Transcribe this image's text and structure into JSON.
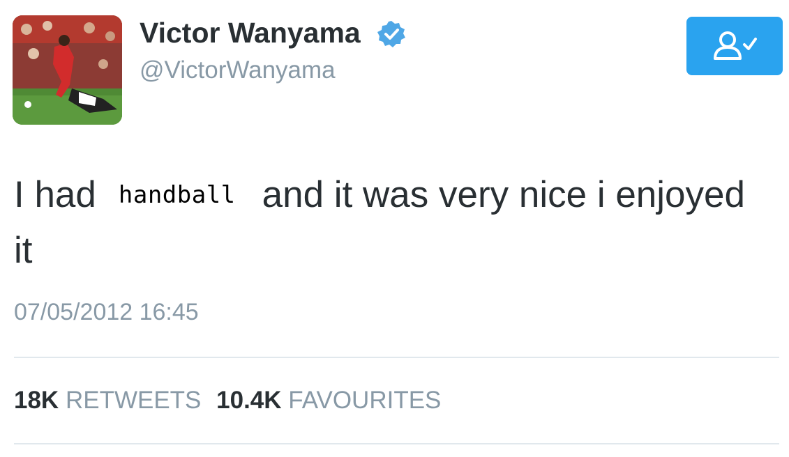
{
  "user": {
    "display_name": "Victor Wanyama",
    "handle": "@VictorWanyama",
    "verified": true,
    "avatar_icon": "football-player-photo"
  },
  "follow_button": {
    "icon": "user-following-check-icon",
    "color": "#2aa3ef"
  },
  "tweet": {
    "text_before": "I had",
    "redacted_word": "handball",
    "text_after": "and it was very nice i enjoyed it",
    "timestamp": "07/05/2012 16:45"
  },
  "stats": {
    "retweets_count": "18K",
    "retweets_label": "RETWEETS",
    "favourites_count": "10.4K",
    "favourites_label": "FAVOURITES"
  },
  "colors": {
    "accent": "#2aa3ef",
    "text": "#292f33",
    "muted": "#8899a6",
    "divider": "#e1e8ed"
  }
}
